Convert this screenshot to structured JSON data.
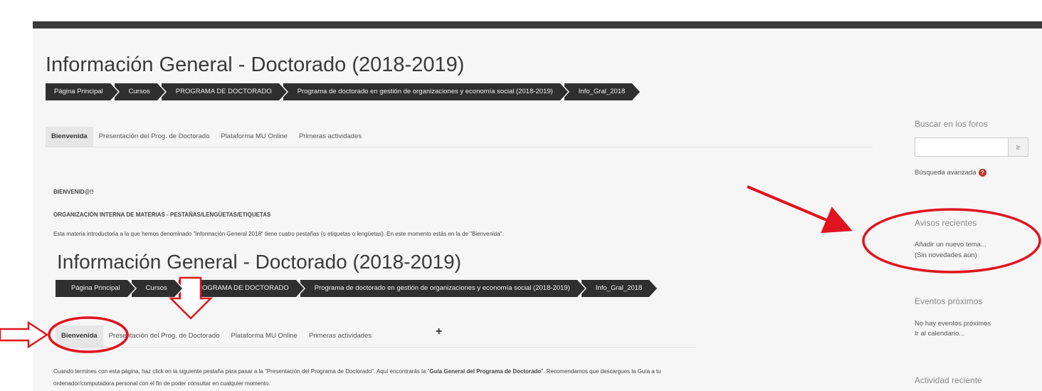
{
  "page": {
    "title": "Información General - Doctorado (2018-2019)",
    "breadcrumb": [
      "Página Principal",
      "Cursos",
      "PROGRAMA DE DOCTORADO",
      "Programa de doctorado en gestión de organizaciones y economía social (2018-2019)",
      "Info_Gral_2018"
    ],
    "tabs": [
      "Bienvenida",
      "Presentación del Prog. de Doctorado",
      "Plataforma MU Online",
      "Primeras actividades"
    ],
    "content": {
      "heading": "BIENVENID@!!",
      "subheading": "ORGANIZACIÓN INTERNA DE MATERIAS - PESTAÑAS/LENGÜETAS/ETIQUETAS",
      "paragraph": "Esta materia introductoria a la que hemos denominado \"Información General 2018\" tiene cuatro pestañas (o etiquetas o lengüetas). En este momento estás en la de \"Bienvenida\"."
    },
    "embedded": {
      "title": "Información General - Doctorado (2018-2019)",
      "breadcrumb": [
        "Página Principal",
        "Cursos",
        "PROGRAMA DE DOCTORADO",
        "Programa de doctorado en gestión de organizaciones y economía social (2018-2019)",
        "Info_Gral_2018"
      ],
      "tabs": [
        "Bienvenida",
        "Presentación del Prog. de Doctorado",
        "Plataforma MU Online",
        "Primeras actividades"
      ],
      "plus": "+"
    },
    "footer_text": {
      "line1_a": "Cuando termines con esta página, haz click en la siguiente pestaña para pasar a la \"Presentación del Programa de Doctorado\".  Aquí encontrarás la \"",
      "line1_bold": "Guía General del Programa de Doctorado",
      "line1_b": "\". Recomendamos que descargues la Guía a tu",
      "line2": "ordenador/computadora personal con el fin de poder consultar en cualquier momento."
    }
  },
  "sidebar": {
    "search_heading": "Buscar en los foros",
    "search_value": "",
    "search_button": "Ir",
    "advanced_search": "Búsqueda avanzada",
    "help_icon": "?",
    "news_heading": "Avisos recientes",
    "news_add": "Añadir un nuevo tema...",
    "news_none": "(Sin novedades aún)",
    "events_heading": "Eventos próximos",
    "events_none": "No hay eventos próximos",
    "events_calendar": "Ir al calendario...",
    "activity_heading": "Actividad reciente"
  },
  "colors": {
    "annotation": "#e0141e",
    "topbar": "#3a3a3a",
    "breadcrumb": "#2f2f2f"
  }
}
